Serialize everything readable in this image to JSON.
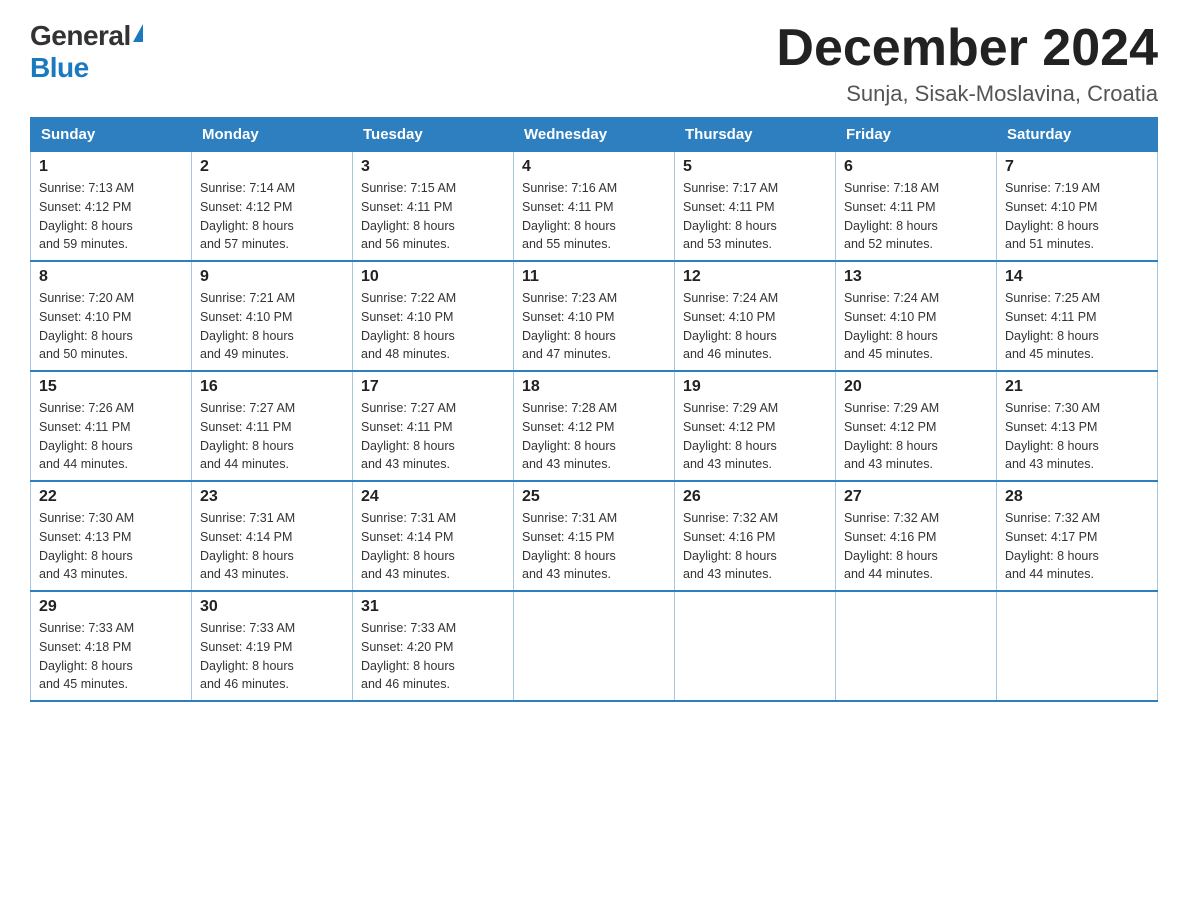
{
  "logo": {
    "general": "General",
    "blue": "Blue"
  },
  "title": "December 2024",
  "location": "Sunja, Sisak-Moslavina, Croatia",
  "headers": [
    "Sunday",
    "Monday",
    "Tuesday",
    "Wednesday",
    "Thursday",
    "Friday",
    "Saturday"
  ],
  "weeks": [
    [
      {
        "day": "1",
        "sunrise": "7:13 AM",
        "sunset": "4:12 PM",
        "daylight": "8 hours and 59 minutes."
      },
      {
        "day": "2",
        "sunrise": "7:14 AM",
        "sunset": "4:12 PM",
        "daylight": "8 hours and 57 minutes."
      },
      {
        "day": "3",
        "sunrise": "7:15 AM",
        "sunset": "4:11 PM",
        "daylight": "8 hours and 56 minutes."
      },
      {
        "day": "4",
        "sunrise": "7:16 AM",
        "sunset": "4:11 PM",
        "daylight": "8 hours and 55 minutes."
      },
      {
        "day": "5",
        "sunrise": "7:17 AM",
        "sunset": "4:11 PM",
        "daylight": "8 hours and 53 minutes."
      },
      {
        "day": "6",
        "sunrise": "7:18 AM",
        "sunset": "4:11 PM",
        "daylight": "8 hours and 52 minutes."
      },
      {
        "day": "7",
        "sunrise": "7:19 AM",
        "sunset": "4:10 PM",
        "daylight": "8 hours and 51 minutes."
      }
    ],
    [
      {
        "day": "8",
        "sunrise": "7:20 AM",
        "sunset": "4:10 PM",
        "daylight": "8 hours and 50 minutes."
      },
      {
        "day": "9",
        "sunrise": "7:21 AM",
        "sunset": "4:10 PM",
        "daylight": "8 hours and 49 minutes."
      },
      {
        "day": "10",
        "sunrise": "7:22 AM",
        "sunset": "4:10 PM",
        "daylight": "8 hours and 48 minutes."
      },
      {
        "day": "11",
        "sunrise": "7:23 AM",
        "sunset": "4:10 PM",
        "daylight": "8 hours and 47 minutes."
      },
      {
        "day": "12",
        "sunrise": "7:24 AM",
        "sunset": "4:10 PM",
        "daylight": "8 hours and 46 minutes."
      },
      {
        "day": "13",
        "sunrise": "7:24 AM",
        "sunset": "4:10 PM",
        "daylight": "8 hours and 45 minutes."
      },
      {
        "day": "14",
        "sunrise": "7:25 AM",
        "sunset": "4:11 PM",
        "daylight": "8 hours and 45 minutes."
      }
    ],
    [
      {
        "day": "15",
        "sunrise": "7:26 AM",
        "sunset": "4:11 PM",
        "daylight": "8 hours and 44 minutes."
      },
      {
        "day": "16",
        "sunrise": "7:27 AM",
        "sunset": "4:11 PM",
        "daylight": "8 hours and 44 minutes."
      },
      {
        "day": "17",
        "sunrise": "7:27 AM",
        "sunset": "4:11 PM",
        "daylight": "8 hours and 43 minutes."
      },
      {
        "day": "18",
        "sunrise": "7:28 AM",
        "sunset": "4:12 PM",
        "daylight": "8 hours and 43 minutes."
      },
      {
        "day": "19",
        "sunrise": "7:29 AM",
        "sunset": "4:12 PM",
        "daylight": "8 hours and 43 minutes."
      },
      {
        "day": "20",
        "sunrise": "7:29 AM",
        "sunset": "4:12 PM",
        "daylight": "8 hours and 43 minutes."
      },
      {
        "day": "21",
        "sunrise": "7:30 AM",
        "sunset": "4:13 PM",
        "daylight": "8 hours and 43 minutes."
      }
    ],
    [
      {
        "day": "22",
        "sunrise": "7:30 AM",
        "sunset": "4:13 PM",
        "daylight": "8 hours and 43 minutes."
      },
      {
        "day": "23",
        "sunrise": "7:31 AM",
        "sunset": "4:14 PM",
        "daylight": "8 hours and 43 minutes."
      },
      {
        "day": "24",
        "sunrise": "7:31 AM",
        "sunset": "4:14 PM",
        "daylight": "8 hours and 43 minutes."
      },
      {
        "day": "25",
        "sunrise": "7:31 AM",
        "sunset": "4:15 PM",
        "daylight": "8 hours and 43 minutes."
      },
      {
        "day": "26",
        "sunrise": "7:32 AM",
        "sunset": "4:16 PM",
        "daylight": "8 hours and 43 minutes."
      },
      {
        "day": "27",
        "sunrise": "7:32 AM",
        "sunset": "4:16 PM",
        "daylight": "8 hours and 44 minutes."
      },
      {
        "day": "28",
        "sunrise": "7:32 AM",
        "sunset": "4:17 PM",
        "daylight": "8 hours and 44 minutes."
      }
    ],
    [
      {
        "day": "29",
        "sunrise": "7:33 AM",
        "sunset": "4:18 PM",
        "daylight": "8 hours and 45 minutes."
      },
      {
        "day": "30",
        "sunrise": "7:33 AM",
        "sunset": "4:19 PM",
        "daylight": "8 hours and 46 minutes."
      },
      {
        "day": "31",
        "sunrise": "7:33 AM",
        "sunset": "4:20 PM",
        "daylight": "8 hours and 46 minutes."
      },
      null,
      null,
      null,
      null
    ]
  ],
  "labels": {
    "sunrise": "Sunrise:",
    "sunset": "Sunset:",
    "daylight": "Daylight:"
  }
}
